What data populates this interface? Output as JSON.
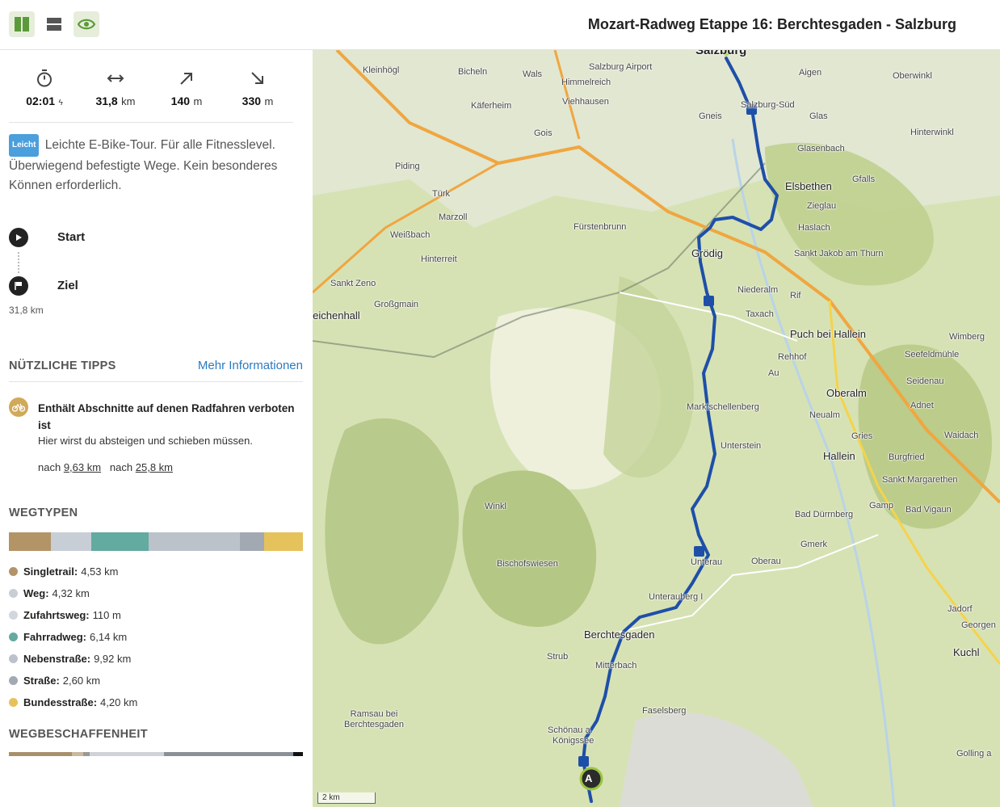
{
  "header": {
    "title": "Mozart-Radweg Etappe 16: Berchtesgaden - Salzburg",
    "accent": "#6aa84f"
  },
  "stats": [
    {
      "icon": "stopwatch-icon",
      "value": "02:01",
      "unit": ""
    },
    {
      "icon": "distance-arrows-icon",
      "value": "31,8",
      "unit": "km"
    },
    {
      "icon": "ascent-arrow-icon",
      "value": "140",
      "unit": "m"
    },
    {
      "icon": "descent-arrow-icon",
      "value": "330",
      "unit": "m"
    }
  ],
  "description": {
    "badge": "Leicht",
    "text": "Leichte E-Bike-Tour. Für alle Fitnesslevel. Überwiegend befestigte Wege. Kein besonderes Können erforderlich."
  },
  "waypoints": {
    "start": "Start",
    "end": "Ziel",
    "distance": "31,8 km"
  },
  "tips": {
    "heading": "NÜTZLICHE TIPPS",
    "more_link": "Mehr Informationen",
    "item": {
      "title": "Enthält Abschnitte auf denen Radfahren verboten ist",
      "text": "Hier wirst du absteigen und schieben müssen.",
      "prefix1": "nach",
      "link1": "9,63 km",
      "prefix2": "nach",
      "link2": "25,8 km"
    }
  },
  "wegtypen": {
    "heading": "WEGTYPEN",
    "items": [
      {
        "name": "Singletrail:",
        "value": "4,53 km",
        "color": "#b39467"
      },
      {
        "name": "Weg:",
        "value": "4,32 km",
        "color": "#c8ced6"
      },
      {
        "name": "Zufahrtsweg:",
        "value": "110 m",
        "color": "#d2d7de"
      },
      {
        "name": "Fahrradweg:",
        "value": "6,14 km",
        "color": "#63aaa0"
      },
      {
        "name": "Nebenstraße:",
        "value": "9,92 km",
        "color": "#bcc2ca"
      },
      {
        "name": "Straße:",
        "value": "2,60 km",
        "color": "#a3a9b2"
      },
      {
        "name": "Bundesstraße:",
        "value": "4,20 km",
        "color": "#e6c25c"
      }
    ]
  },
  "wegbeschaffenheit": {
    "heading": "WEGBESCHAFFENHEIT"
  },
  "map": {
    "scale": "2 km",
    "marker_start": "A",
    "route_color": "#1e4fa8",
    "labels": [
      {
        "text": "Salzburg",
        "big": true
      },
      {
        "text": "Kleinhögl"
      },
      {
        "text": "Bicheln"
      },
      {
        "text": "Wals"
      },
      {
        "text": "Salzburg Airport"
      },
      {
        "text": "Himmelreich"
      },
      {
        "text": "Käferheim"
      },
      {
        "text": "Viehhausen"
      },
      {
        "text": "Aigen"
      },
      {
        "text": "Oberwinkl"
      },
      {
        "text": "Gneis"
      },
      {
        "text": "Glas"
      },
      {
        "text": "Salzburg-Süd"
      },
      {
        "text": "Hinterwinkl"
      },
      {
        "text": "Gois"
      },
      {
        "text": "Piding"
      },
      {
        "text": "Glasenbach"
      },
      {
        "text": "Elsbethen",
        "big": true
      },
      {
        "text": "Gfalls"
      },
      {
        "text": "Türk"
      },
      {
        "text": "Zieglau"
      },
      {
        "text": "Marzoll"
      },
      {
        "text": "Fürstenbrunn"
      },
      {
        "text": "Haslach"
      },
      {
        "text": "Weißbach"
      },
      {
        "text": "Sankt Jakob am Thurn"
      },
      {
        "text": "Hinterreit"
      },
      {
        "text": "Grödig",
        "big": true
      },
      {
        "text": "Sankt Zeno"
      },
      {
        "text": "Niederalm"
      },
      {
        "text": "Großgmain"
      },
      {
        "text": "Rif"
      },
      {
        "text": "Bad Reichenhall",
        "big": true
      },
      {
        "text": "Taxach"
      },
      {
        "text": "Puch bei Hallein",
        "big": true
      },
      {
        "text": "Wimberg"
      },
      {
        "text": "Seefeldmühle"
      },
      {
        "text": "Rehhof"
      },
      {
        "text": "Au"
      },
      {
        "text": "Seidenau"
      },
      {
        "text": "Oberalm",
        "big": true
      },
      {
        "text": "Adnet"
      },
      {
        "text": "Marktschellenberg"
      },
      {
        "text": "Neualm"
      },
      {
        "text": "Waidach"
      },
      {
        "text": "Gries"
      },
      {
        "text": "Unterstein"
      },
      {
        "text": "Hallein",
        "big": true
      },
      {
        "text": "Burgfried"
      },
      {
        "text": "Sankt Margarethen"
      },
      {
        "text": "Winkl"
      },
      {
        "text": "Bad Dürrnberg"
      },
      {
        "text": "Gamp"
      },
      {
        "text": "Bad Vigaun"
      },
      {
        "text": "Gmerk"
      },
      {
        "text": "Bischofswiesen"
      },
      {
        "text": "Unterau"
      },
      {
        "text": "Oberau"
      },
      {
        "text": "Unterauberg I"
      },
      {
        "text": "Jadorf"
      },
      {
        "text": "Georgen"
      },
      {
        "text": "Berchtesgaden",
        "big": true
      },
      {
        "text": "Strub"
      },
      {
        "text": "Mitterbach"
      },
      {
        "text": "Kuchl",
        "big": true
      },
      {
        "text": "Faselsberg"
      },
      {
        "text": "Ramsau bei Berchtesgaden"
      },
      {
        "text": "Schönau a."
      },
      {
        "text": "Königssee"
      },
      {
        "text": "Golling a"
      }
    ]
  }
}
